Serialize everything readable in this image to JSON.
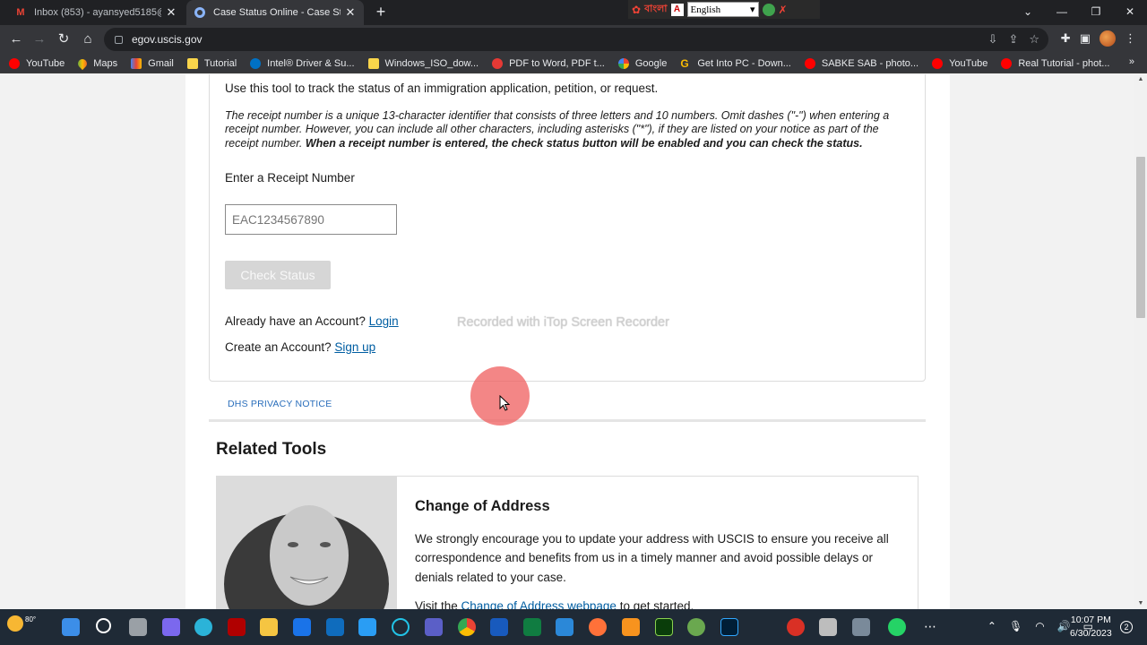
{
  "browser": {
    "tabs": [
      {
        "title": "Inbox (853) - ayansyed5185@gm",
        "favicon": "gmail-icon"
      },
      {
        "title": "Case Status Online - Case Status",
        "favicon": "uscis-seal-icon"
      }
    ],
    "translate": {
      "bengali_text": "বাংলা",
      "language": "English"
    },
    "url": "egov.uscis.gov",
    "bookmarks": [
      {
        "label": "YouTube",
        "icon": "youtube-icon"
      },
      {
        "label": "Maps",
        "icon": "maps-icon"
      },
      {
        "label": "Gmail",
        "icon": "gmail-icon"
      },
      {
        "label": "Tutorial",
        "icon": "folder-icon"
      },
      {
        "label": "Intel® Driver & Su...",
        "icon": "intel-icon"
      },
      {
        "label": "Windows_ISO_dow...",
        "icon": "folder-icon"
      },
      {
        "label": "PDF to Word, PDF t...",
        "icon": "pdf-icon"
      },
      {
        "label": "Google",
        "icon": "google-icon"
      },
      {
        "label": "Get Into PC - Down...",
        "icon": "getintopc-icon"
      },
      {
        "label": "SABKE SAB - photo...",
        "icon": "youtube-icon"
      },
      {
        "label": "YouTube",
        "icon": "youtube-icon"
      },
      {
        "label": "Real Tutorial - phot...",
        "icon": "youtube-icon"
      }
    ]
  },
  "page": {
    "intro": "Use this tool to track the status of an immigration application, petition, or request.",
    "note_italic": "The receipt number is a unique 13-character identifier that consists of three letters and 10 numbers. Omit dashes (\"-\") when entering a receipt number. However, you can include all other characters, including asterisks (\"*\"), if they are listed on your notice as part of the receipt number.",
    "note_bold": "When a receipt number is entered, the check status button will be enabled and you can check the status.",
    "receipt_label": "Enter a Receipt Number",
    "receipt_placeholder": "EAC1234567890",
    "check_button": "Check Status",
    "account_prompt": "Already have an Account?",
    "login_link": "Login",
    "create_prompt": "Create an Account?",
    "signup_link": "Sign up",
    "privacy_notice": "DHS PRIVACY NOTICE",
    "related_heading": "Related Tools",
    "related_tool": {
      "title": "Change of Address",
      "description": "We strongly encourage you to update your address with USCIS to ensure you receive all correspondence and benefits from us in a timely manner and avoid possible delays or denials related to your case.",
      "visit_prefix": "Visit the",
      "visit_link": "Change of Address webpage",
      "visit_suffix": "to get started."
    }
  },
  "overlay": {
    "watermark": "Recorded with iTop Screen Recorder"
  },
  "taskbar": {
    "weather": "80°",
    "time": "10:07 PM",
    "date": "6/30/2023",
    "notifications": "2"
  },
  "colors": {
    "link": "#005ea2",
    "privacy_link": "#2a6ebb",
    "disabled_button": "#d6d6d6"
  }
}
